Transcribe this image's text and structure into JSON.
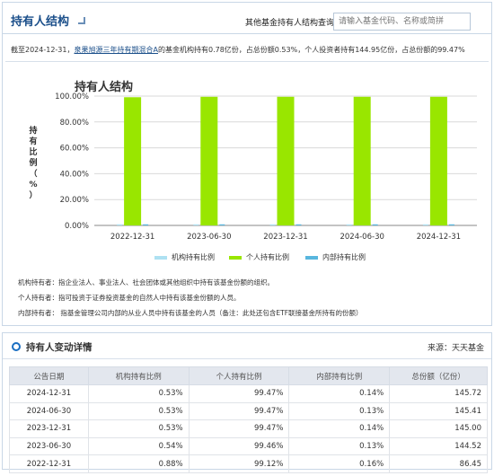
{
  "header": {
    "title": "持有人结构",
    "search_label": "其他基金持有人结构查询:",
    "search_placeholder": "请输入基金代码、名称或简拼"
  },
  "summary": {
    "prefix": "截至2024-12-31，",
    "fund_link": "泉果旭源三年持有期混合A",
    "suffix": "的基金机构持有0.78亿份，占总份额0.53%，个人投资者持有144.95亿份，占总份额的99.47%"
  },
  "chart_data": {
    "type": "bar",
    "title": "持有人结构",
    "ylabel": "持有比例（%）",
    "xlabel": "",
    "ylim": [
      0,
      100
    ],
    "y_ticks": [
      "0.00%",
      "20.00%",
      "40.00%",
      "60.00%",
      "80.00%",
      "100.00%"
    ],
    "categories": [
      "2022-12-31",
      "2023-06-30",
      "2023-12-31",
      "2024-06-30",
      "2024-12-31"
    ],
    "series": [
      {
        "name": "机构持有比例",
        "color": "#aee1f2",
        "values": [
          0.88,
          0.54,
          0.53,
          0.53,
          0.53
        ]
      },
      {
        "name": "个人持有比例",
        "color": "#99e600",
        "values": [
          99.12,
          99.46,
          99.47,
          99.47,
          99.47
        ]
      },
      {
        "name": "内部持有比例",
        "color": "#58b6de",
        "values": [
          0.16,
          0.13,
          0.14,
          0.13,
          0.14
        ]
      }
    ],
    "legend_position": "bottom"
  },
  "definitions": [
    "机构持有者：指企业法人、事业法人、社会团体或其他组织中持有该基金份额的组织。",
    "个人持有者：指可投资于证券投资基金的自然人中持有该基金份额的人员。",
    "内部持有者： 指基金管理公司内部的从业人员中持有该基金的人员（备注：此处还包含ETF联接基金所持有的份额）"
  ],
  "detail": {
    "title": "持有人变动详情",
    "source": "来源：天天基金",
    "columns": [
      "公告日期",
      "机构持有比例",
      "个人持有比例",
      "内部持有比例",
      "总份额（亿份）"
    ],
    "rows": [
      [
        "2024-12-31",
        "0.53%",
        "99.47%",
        "0.14%",
        "145.72"
      ],
      [
        "2024-06-30",
        "0.53%",
        "99.47%",
        "0.13%",
        "145.41"
      ],
      [
        "2023-12-31",
        "0.53%",
        "99.47%",
        "0.14%",
        "145.00"
      ],
      [
        "2023-06-30",
        "0.54%",
        "99.46%",
        "0.13%",
        "144.52"
      ],
      [
        "2022-12-31",
        "0.88%",
        "99.12%",
        "0.16%",
        "86.45"
      ]
    ]
  }
}
